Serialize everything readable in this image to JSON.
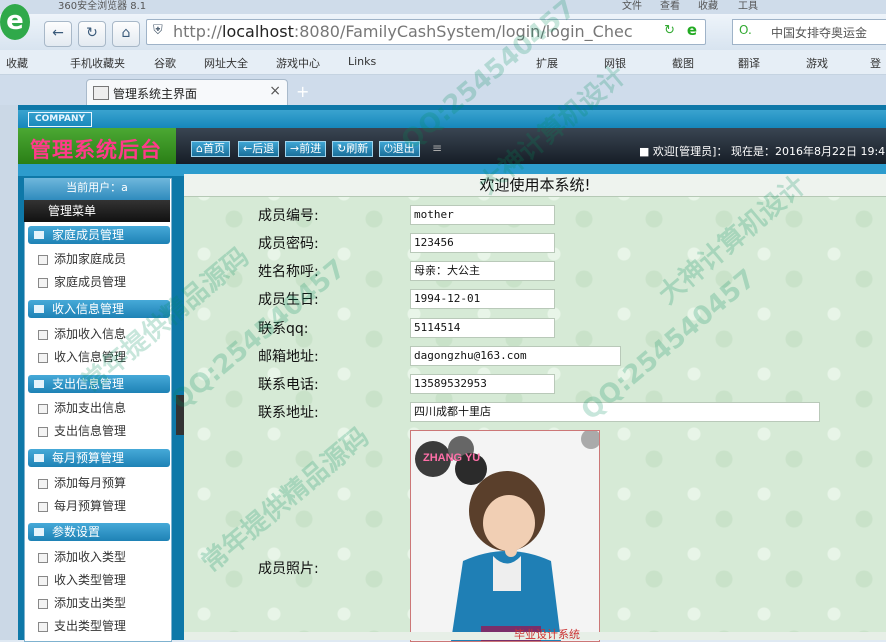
{
  "browser": {
    "window_title": "360安全浏览器 8.1",
    "top_menu": [
      "文件",
      "查看",
      "收藏",
      "工具"
    ],
    "url_host": "localhost",
    "url_rest": ":8080/FamilyCashSystem/login/login_CheckLogin.actic",
    "search_text": "中国女排夺奥运金",
    "bookmarks_left": [
      "收藏",
      "手机收藏夹",
      "谷歌",
      "网址大全",
      "游戏中心",
      "Links"
    ],
    "bookmarks_right": [
      "扩展",
      "网银",
      "截图",
      "翻译",
      "游戏",
      "登"
    ],
    "tab_title": "管理系统主界面"
  },
  "header": {
    "company": "COMPANY",
    "logo_text": "管理系统后台",
    "nav": [
      "首页",
      "后退",
      "前进",
      "刷新",
      "退出"
    ],
    "welcome": "欢迎[管理员]：  现在是：2016年8月22日 19:4"
  },
  "sidebar": {
    "current_user": "当前用户：a",
    "menu_title": "管理菜单",
    "groups": [
      {
        "title": "家庭成员管理",
        "items": [
          "添加家庭成员",
          "家庭成员管理"
        ]
      },
      {
        "title": "收入信息管理",
        "items": [
          "添加收入信息",
          "收入信息管理"
        ]
      },
      {
        "title": "支出信息管理",
        "items": [
          "添加支出信息",
          "支出信息管理"
        ]
      },
      {
        "title": "每月预算管理",
        "items": [
          "添加每月预算",
          "每月预算管理"
        ]
      },
      {
        "title": "参数设置",
        "items": [
          "添加收入类型",
          "收入类型管理",
          "添加支出类型",
          "支出类型管理"
        ]
      }
    ]
  },
  "main": {
    "title": "欢迎使用本系统!",
    "fields": [
      {
        "label": "成员编号:",
        "value": "mother"
      },
      {
        "label": "成员密码:",
        "value": "123456"
      },
      {
        "label": "姓名称呼:",
        "value": "母亲：大公主"
      },
      {
        "label": "成员生日:",
        "value": "1994-12-01"
      },
      {
        "label": "联系qq:",
        "value": "5114514"
      },
      {
        "label": "邮箱地址:",
        "value": "dagongzhu@163.com"
      },
      {
        "label": "联系电话:",
        "value": "13589532953"
      },
      {
        "label": "联系地址:",
        "value": "四川成都十里店"
      }
    ],
    "photo_label": "成员照片:",
    "photo_text": "ZHANG YU"
  },
  "watermarks": [
    "QQ:254540457",
    "大神计算机设计",
    "常年提供精品源码"
  ],
  "footer_text": "毕业设计系统"
}
